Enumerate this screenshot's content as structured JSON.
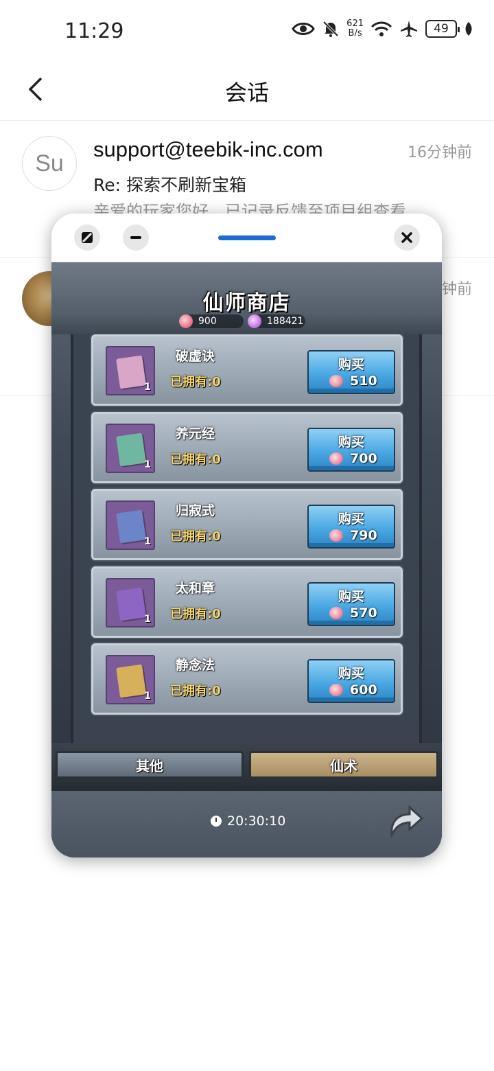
{
  "status_bar": {
    "time": "11:29",
    "net_speed_value": "621",
    "net_speed_unit": "B/s",
    "battery": "49"
  },
  "nav": {
    "title": "会话"
  },
  "conversations": [
    {
      "avatar_text": "Su",
      "sender": "support@teebik-inc.com",
      "time": "16分钟前",
      "subject": "Re: 探索不刷新宝箱",
      "preview": "亲爱的玩家您好，已记录反馈至项目组查看"
    },
    {
      "time": "钟前"
    }
  ],
  "game": {
    "title": "仙师商店",
    "currency_peach": "900",
    "currency_gem": "188421",
    "items": [
      {
        "name": "破虚诀",
        "owned": "已拥有:0",
        "qty": "1",
        "buy_label": "购买",
        "price": "510",
        "book_color": "#d9a6c8"
      },
      {
        "name": "养元经",
        "owned": "已拥有:0",
        "qty": "1",
        "buy_label": "购买",
        "price": "700",
        "book_color": "#6fb7a0"
      },
      {
        "name": "归寂式",
        "owned": "已拥有:0",
        "qty": "1",
        "buy_label": "购买",
        "price": "790",
        "book_color": "#6c85c9"
      },
      {
        "name": "太和章",
        "owned": "已拥有:0",
        "qty": "1",
        "buy_label": "购买",
        "price": "570",
        "book_color": "#8e65c2"
      },
      {
        "name": "静念法",
        "owned": "已拥有:0",
        "qty": "1",
        "buy_label": "购买",
        "price": "600",
        "book_color": "#d6b05a"
      }
    ],
    "tabs": [
      "其他",
      "仙术"
    ],
    "timer": "20:30:10"
  }
}
